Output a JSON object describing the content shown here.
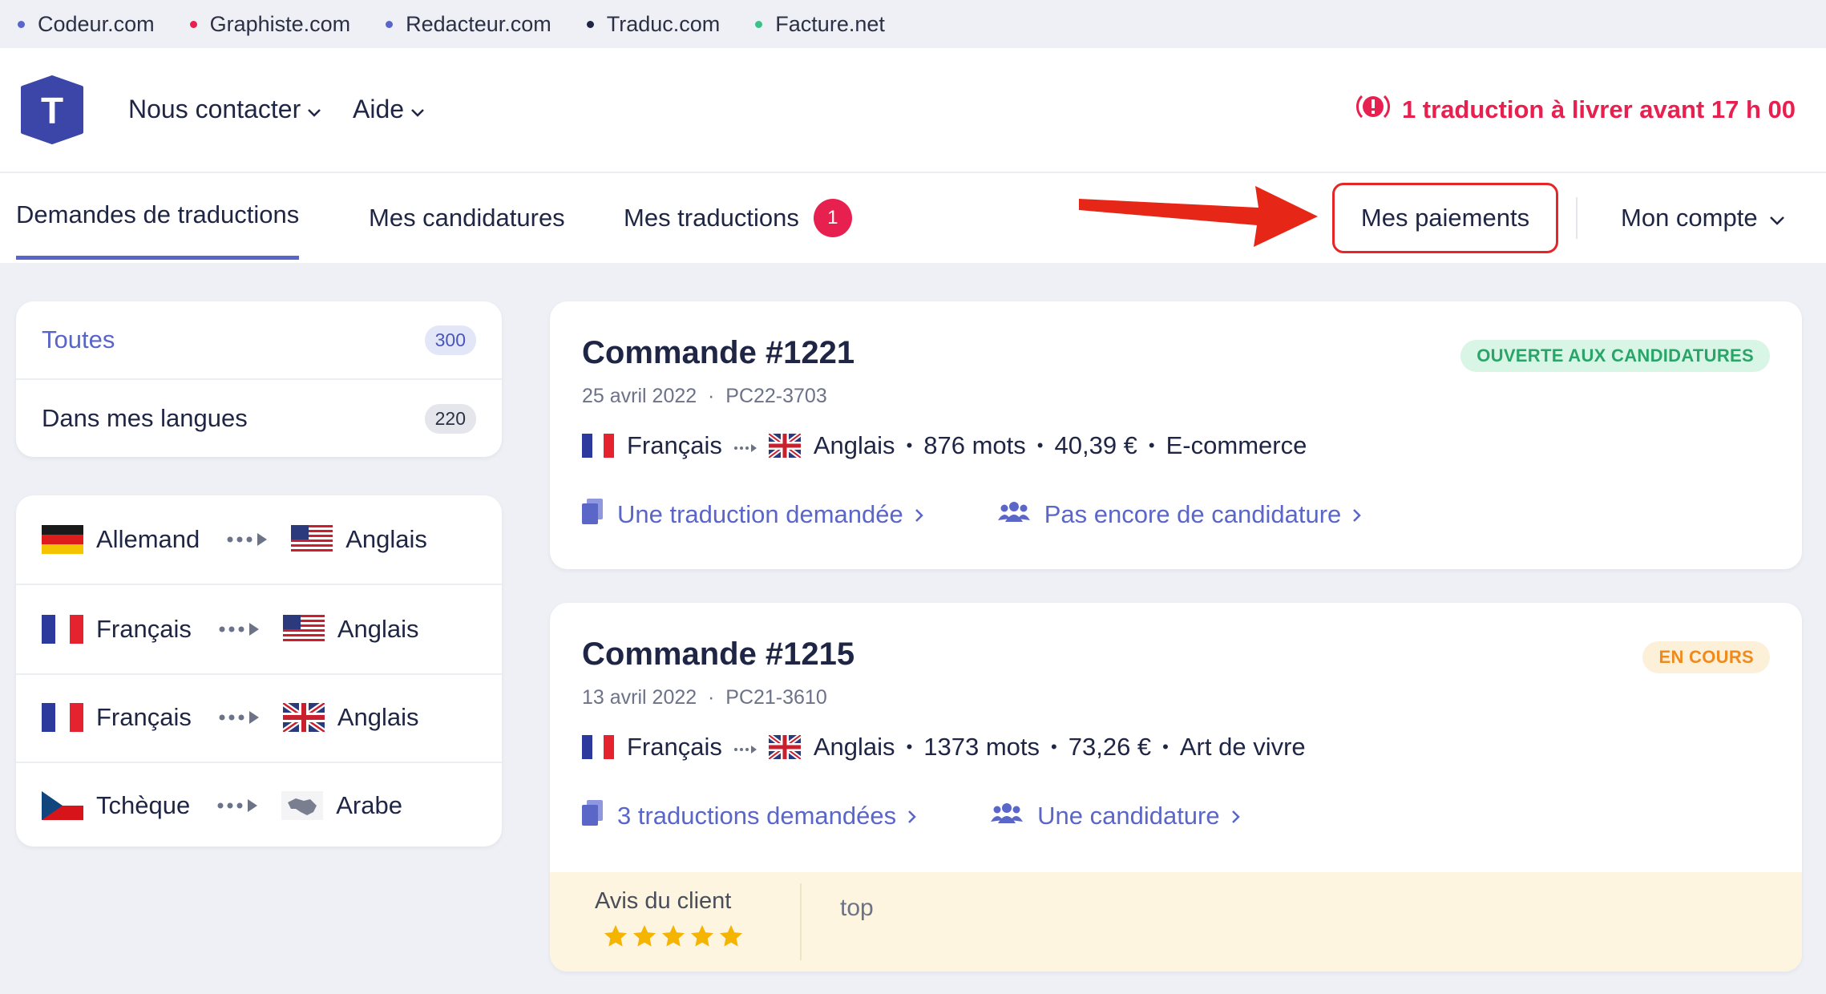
{
  "network": [
    {
      "label": "Codeur.com",
      "color": "#5865c9"
    },
    {
      "label": "Graphiste.com",
      "color": "#e8204f"
    },
    {
      "label": "Redacteur.com",
      "color": "#5865c9"
    },
    {
      "label": "Traduc.com",
      "color": "#1f2544"
    },
    {
      "label": "Facture.net",
      "color": "#3cc18a"
    }
  ],
  "header": {
    "logo_letter": "T",
    "contact_label": "Nous contacter",
    "help_label": "Aide",
    "alert_text": "1 traduction à livrer avant 17 h 00"
  },
  "tabs": {
    "requests": "Demandes de traductions",
    "applications": "Mes candidatures",
    "translations": "Mes traductions",
    "translations_badge": "1",
    "payments": "Mes paiements",
    "account": "Mon compte"
  },
  "filters": {
    "all_label": "Toutes",
    "all_count": "300",
    "mine_label": "Dans mes langues",
    "mine_count": "220"
  },
  "language_pairs": [
    {
      "from": "Allemand",
      "to": "Anglais"
    },
    {
      "from": "Français",
      "to": "Anglais"
    },
    {
      "from": "Français",
      "to": "Anglais"
    },
    {
      "from": "Tchèque",
      "to": "Arabe"
    }
  ],
  "orders": [
    {
      "title": "Commande #1221",
      "date": "25 avril 2022",
      "ref": "PC22-3703",
      "status": "OUVERTE AUX CANDIDATURES",
      "from": "Français",
      "to": "Anglais",
      "words": "876 mots",
      "price": "40,39 €",
      "category": "E-commerce",
      "link1": "Une traduction demandée",
      "link2": "Pas encore de candidature"
    },
    {
      "title": "Commande #1215",
      "date": "13 avril 2022",
      "ref": "PC21-3610",
      "status": "EN COURS",
      "from": "Français",
      "to": "Anglais",
      "words": "1373 mots",
      "price": "73,26 €",
      "category": "Art de vivre",
      "link1": "3 traductions demandées",
      "link2": "Une candidature",
      "review_label": "Avis du client",
      "review_text": "top",
      "stars": 5
    }
  ],
  "colors": {
    "accent": "#5865c9",
    "alert": "#e8204f",
    "open_status_bg": "#d9f5e6",
    "open_status_fg": "#2aa56a",
    "progress_status_bg": "#fdf0d9",
    "progress_status_fg": "#ef8b1e"
  }
}
